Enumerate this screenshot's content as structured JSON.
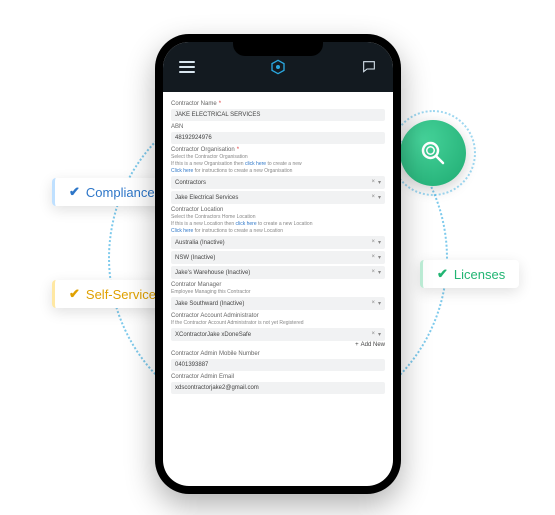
{
  "badges": {
    "compliance": "Compliance",
    "self_service": "Self-Service",
    "licenses": "Licenses"
  },
  "form": {
    "contractor_name": {
      "label": "Contractor Name",
      "value": "JAKE ELECTRICAL SERVICES"
    },
    "abn": {
      "label": "ABN",
      "value": "48192924976"
    },
    "org": {
      "label": "Contractor Organisation",
      "hint_select": "Select the Contractor Organisation",
      "hint_new1_a": "If this is a new Organisation then ",
      "hint_new1_link": "click here",
      "hint_new1_b": " to create a new",
      "hint_new2_link": "Click here",
      "hint_new2_b": " for instructions to create a new Organisation",
      "value1": "Contractors",
      "value2": "Jake Electrical Services"
    },
    "loc": {
      "label": "Contractor Location",
      "hint_select": "Select the Contractors Home Location",
      "hint_new1_a": "If this is a new Location then ",
      "hint_new1_link": "click here",
      "hint_new1_b": " to create a new Location",
      "hint_new2_link": "Click here",
      "hint_new2_b": " for instructions to create a new Location",
      "value1": "Australia (Inactive)",
      "value2": "NSW (Inactive)",
      "value3": "Jake's Warehouse (Inactive)"
    },
    "manager": {
      "label": "Contrator Manager",
      "hint": "Employee Managing this Contractor",
      "value": "Jake Southward (Inactive)"
    },
    "admin": {
      "label": "Contractor Account Administrator",
      "hint": "If the Contractor Account Administrator is not yet Registered",
      "value": "XContractorJake xDoneSafe",
      "add_new": "Add New"
    },
    "mobile": {
      "label": "Contractor Admin Mobile Number",
      "value": "0401393887"
    },
    "email": {
      "label": "Contractor Admin Email",
      "value": "xdscontractorjake2@gmail.com"
    }
  },
  "icons": {
    "clear": "×",
    "drop": "▾",
    "plus": "+"
  }
}
